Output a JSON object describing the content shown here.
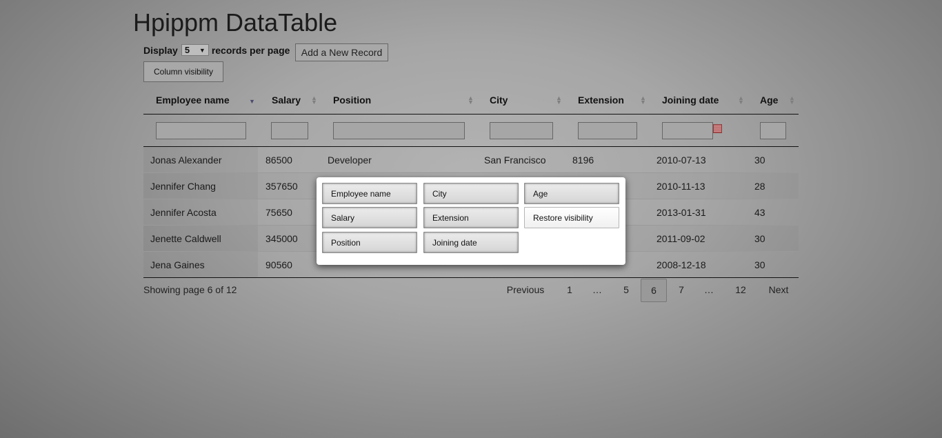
{
  "page": {
    "title": "Hpippm DataTable"
  },
  "controls": {
    "display_label": "Display",
    "per_page_value": "5",
    "per_page_suffix": "records per page",
    "add_record_label": "Add a New Record",
    "column_visibility_label": "Column visibility"
  },
  "table": {
    "headers": [
      "Employee name",
      "Salary",
      "Position",
      "City",
      "Extension",
      "Joining date",
      "Age"
    ],
    "rows": [
      [
        "Jonas Alexander",
        "86500",
        "Developer",
        "San Francisco",
        "8196",
        "2010-07-13",
        "30"
      ],
      [
        "Jennifer Chang",
        "357650",
        "",
        "",
        "",
        "2010-11-13",
        "28"
      ],
      [
        "Jennifer Acosta",
        "75650",
        "",
        "",
        "",
        "2013-01-31",
        "43"
      ],
      [
        "Jenette Caldwell",
        "345000",
        "",
        "",
        "",
        "2011-09-02",
        "30"
      ],
      [
        "Jena Gaines",
        "90560",
        "",
        "",
        "",
        "2008-12-18",
        "30"
      ]
    ]
  },
  "footer": {
    "info": "Showing page 6 of 12",
    "pagination": {
      "previous": "Previous",
      "next": "Next",
      "pages": [
        "1",
        "…",
        "5",
        "6",
        "7",
        "…",
        "12"
      ],
      "current": "6"
    }
  },
  "column_visibility_popup": {
    "buttons": [
      "Employee name",
      "City",
      "Age",
      "Salary",
      "Extension",
      "Restore visibility",
      "Position",
      "Joining date"
    ]
  },
  "colors": {
    "overlay": "#9e9e9e",
    "popup_bg": "#ffffff",
    "calendar_icon": "#b45a5a"
  },
  "icons": {
    "sort": "sort-arrows-icon",
    "calendar": "calendar-icon",
    "dropdown": "chevron-down-icon"
  }
}
